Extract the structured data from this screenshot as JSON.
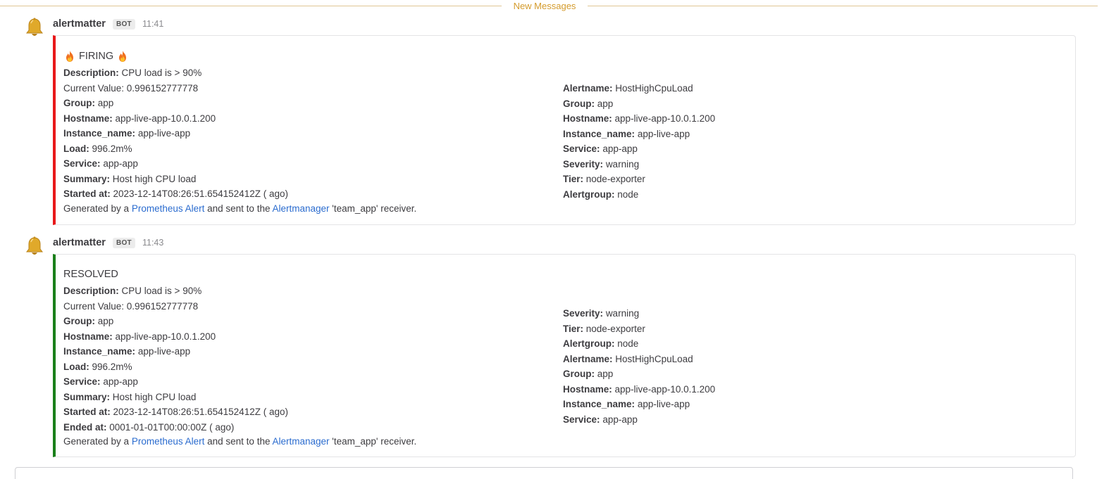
{
  "divider": {
    "label": "New Messages"
  },
  "posts": [
    {
      "username": "alertmatter",
      "badge": "BOT",
      "time": "11:41",
      "avatar_icon": "bell-icon",
      "status_color": "#e8181a",
      "title": "FIRING",
      "left_fields": [
        {
          "k": "Description:",
          "v": "CPU load is > 90%"
        },
        {
          "k": "",
          "v": "Current Value: 0.996152777778"
        },
        {
          "k": "Group:",
          "v": "app"
        },
        {
          "k": "Hostname:",
          "v": "app-live-app-10.0.1.200"
        },
        {
          "k": "Instance_name:",
          "v": "app-live-app"
        },
        {
          "k": "Load:",
          "v": "996.2m%"
        },
        {
          "k": "Service:",
          "v": "app-app"
        },
        {
          "k": "Summary:",
          "v": "Host high CPU load"
        },
        {
          "k": "Started at:",
          "v": "2023-12-14T08:26:51.654152412Z ( ago)"
        }
      ],
      "right_fields": [
        {
          "k": "Alertname:",
          "v": "HostHighCpuLoad"
        },
        {
          "k": "Group:",
          "v": "app"
        },
        {
          "k": "Hostname:",
          "v": "app-live-app-10.0.1.200"
        },
        {
          "k": "Instance_name:",
          "v": "app-live-app"
        },
        {
          "k": "Service:",
          "v": "app-app"
        },
        {
          "k": "Severity:",
          "v": "warning"
        },
        {
          "k": "Tier:",
          "v": "node-exporter"
        },
        {
          "k": "Alertgroup:",
          "v": "node"
        }
      ],
      "footer": {
        "pre": "Generated by a ",
        "link1": "Prometheus Alert",
        "mid": " and sent to the ",
        "link2": "Alertmanager",
        "post": " 'team_app' receiver."
      }
    },
    {
      "username": "alertmatter",
      "badge": "BOT",
      "time": "11:43",
      "avatar_icon": "bell-icon",
      "status_color": "#1a7f1a",
      "title": "RESOLVED",
      "left_fields": [
        {
          "k": "Description:",
          "v": "CPU load is > 90%"
        },
        {
          "k": "",
          "v": "Current Value: 0.996152777778"
        },
        {
          "k": "Group:",
          "v": "app"
        },
        {
          "k": "Hostname:",
          "v": "app-live-app-10.0.1.200"
        },
        {
          "k": "Instance_name:",
          "v": "app-live-app"
        },
        {
          "k": "Load:",
          "v": "996.2m%"
        },
        {
          "k": "Service:",
          "v": "app-app"
        },
        {
          "k": "Summary:",
          "v": "Host high CPU load"
        },
        {
          "k": "Started at:",
          "v": "2023-12-14T08:26:51.654152412Z ( ago)"
        },
        {
          "k": "Ended at:",
          "v": "0001-01-01T00:00:00Z ( ago)"
        }
      ],
      "right_fields": [
        {
          "k": "Severity:",
          "v": "warning"
        },
        {
          "k": "Tier:",
          "v": "node-exporter"
        },
        {
          "k": "Alertgroup:",
          "v": "node"
        },
        {
          "k": "Alertname:",
          "v": "HostHighCpuLoad"
        },
        {
          "k": "Group:",
          "v": "app"
        },
        {
          "k": "Hostname:",
          "v": "app-live-app-10.0.1.200"
        },
        {
          "k": "Instance_name:",
          "v": "app-live-app"
        },
        {
          "k": "Service:",
          "v": "app-app"
        }
      ],
      "footer": {
        "pre": "Generated by a ",
        "link1": "Prometheus Alert",
        "mid": " and sent to the ",
        "link2": "Alertmanager",
        "post": " 'team_app' receiver."
      }
    }
  ]
}
